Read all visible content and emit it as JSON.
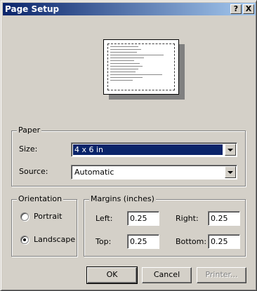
{
  "window": {
    "title": "Page Setup",
    "help_glyph": "?",
    "close_glyph": "X"
  },
  "paper": {
    "group_label": "Paper",
    "size_label": "Size:",
    "size_value": "4 x 6 in",
    "source_label": "Source:",
    "source_value": "Automatic"
  },
  "orientation": {
    "group_label": "Orientation",
    "portrait_label": "Portrait",
    "landscape_label": "Landscape",
    "selected": "Landscape"
  },
  "margins": {
    "group_label": "Margins (inches)",
    "left_label": "Left:",
    "left_value": "0.25",
    "right_label": "Right:",
    "right_value": "0.25",
    "top_label": "Top:",
    "top_value": "0.25",
    "bottom_label": "Bottom:",
    "bottom_value": "0.25"
  },
  "buttons": {
    "ok": "OK",
    "cancel": "Cancel",
    "printer": "Printer..."
  },
  "colors": {
    "titlebar_start": "#0a246a",
    "titlebar_end": "#a6caf0",
    "face": "#d4d0c8",
    "selection": "#0a246a"
  }
}
